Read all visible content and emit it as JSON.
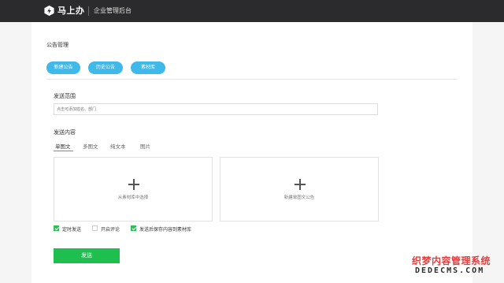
{
  "header": {
    "brand": "马上办",
    "app_title": "企业管理后台"
  },
  "page": {
    "title": "公告管理"
  },
  "actions": {
    "new_notice": "新建公告",
    "history_notice": "历史公告",
    "material_library": "素材库"
  },
  "send_range": {
    "label": "发送范围",
    "placeholder": "点击可添加姓名、部门"
  },
  "send_content": {
    "label": "发送内容",
    "tabs": [
      "单图文",
      "多图文",
      "纯文本",
      "图片"
    ],
    "active_tab": "单图文",
    "boxes": {
      "pick_from_library": "从素材库中选择",
      "new_single_article": "新建单图文公告"
    }
  },
  "options": [
    {
      "label": "定时发送",
      "checked": true
    },
    {
      "label": "开启评论",
      "checked": false
    },
    {
      "label": "发送后保存内容到素材库",
      "checked": true
    }
  ],
  "submit": {
    "label": "发送"
  },
  "watermark": {
    "line1": "织梦内容管理系统",
    "line2": "DEDECMS.COM"
  },
  "colors": {
    "topbar": "#2b2b2e",
    "pill_button": "#3fb8ea",
    "primary_green": "#1fbf4f"
  }
}
